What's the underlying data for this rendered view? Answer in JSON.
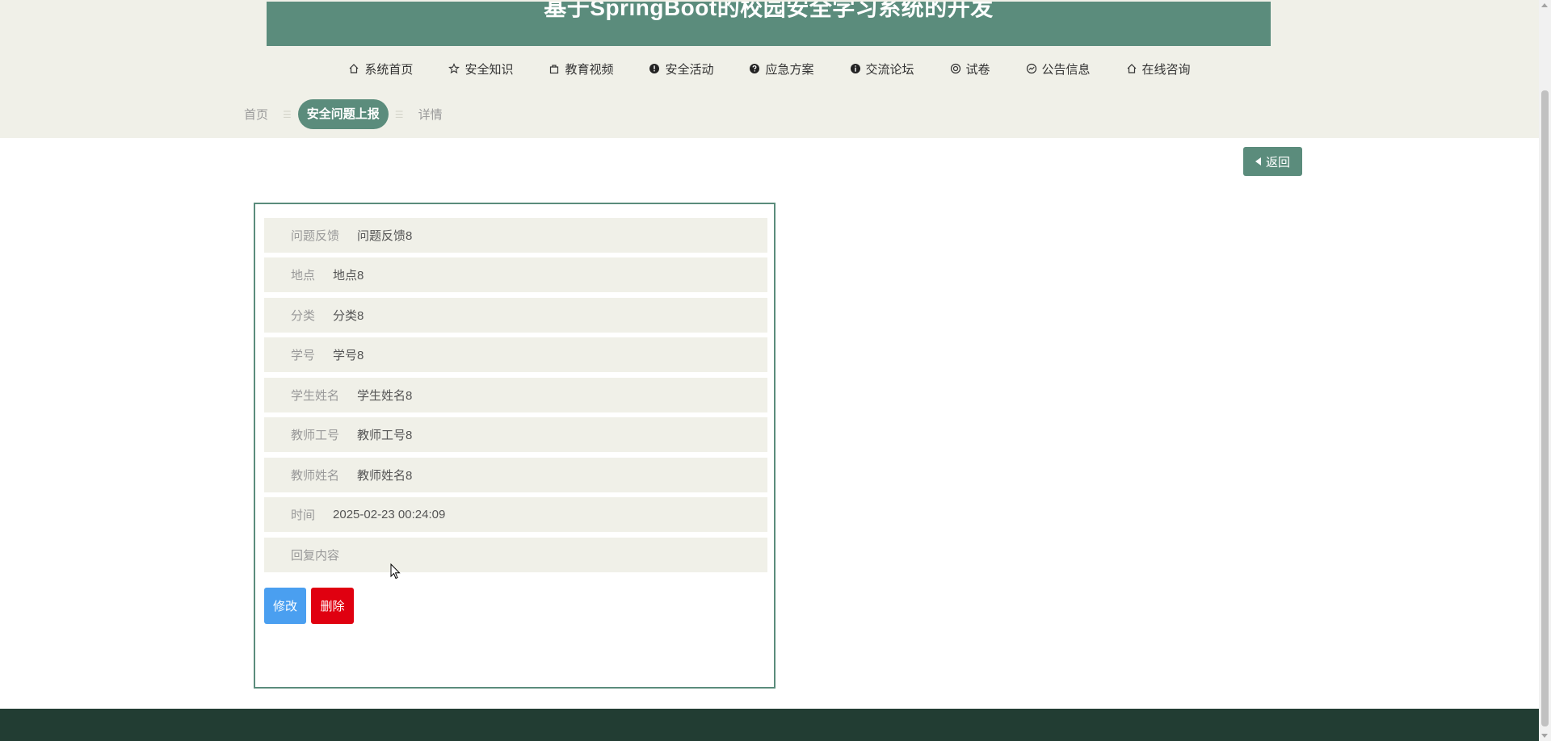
{
  "header": {
    "title": "基于SpringBoot的校园安全学习系统的开发"
  },
  "nav": {
    "items": [
      {
        "label": "系统首页",
        "icon": "home-icon"
      },
      {
        "label": "安全知识",
        "icon": "star-icon"
      },
      {
        "label": "教育视频",
        "icon": "bag-icon"
      },
      {
        "label": "安全活动",
        "icon": "exclamation-circle-icon"
      },
      {
        "label": "应急方案",
        "icon": "question-circle-icon"
      },
      {
        "label": "交流论坛",
        "icon": "info-circle-icon"
      },
      {
        "label": "试卷",
        "icon": "lifebuoy-icon"
      },
      {
        "label": "公告信息",
        "icon": "trend-circle-icon"
      },
      {
        "label": "在线咨询",
        "icon": "home-icon"
      }
    ]
  },
  "breadcrumb": {
    "home": "首页",
    "current": "安全问题上报",
    "detail": "详情"
  },
  "back_button": "返回",
  "detail": {
    "rows": [
      {
        "label": "问题反馈",
        "value": "问题反馈8"
      },
      {
        "label": "地点",
        "value": "地点8"
      },
      {
        "label": "分类",
        "value": "分类8"
      },
      {
        "label": "学号",
        "value": "学号8"
      },
      {
        "label": "学生姓名",
        "value": "学生姓名8"
      },
      {
        "label": "教师工号",
        "value": "教师工号8"
      },
      {
        "label": "教师姓名",
        "value": "教师姓名8"
      },
      {
        "label": "时间",
        "value": "2025-02-23 00:24:09"
      },
      {
        "label": "回复内容",
        "value": ""
      }
    ],
    "edit_label": "修改",
    "delete_label": "删除"
  },
  "colors": {
    "primary": "#5b8c7c",
    "header_bg": "#f0f0e8",
    "footer_bg": "#223d33",
    "edit_btn": "#4a9ff0",
    "delete_btn": "#e00010"
  }
}
